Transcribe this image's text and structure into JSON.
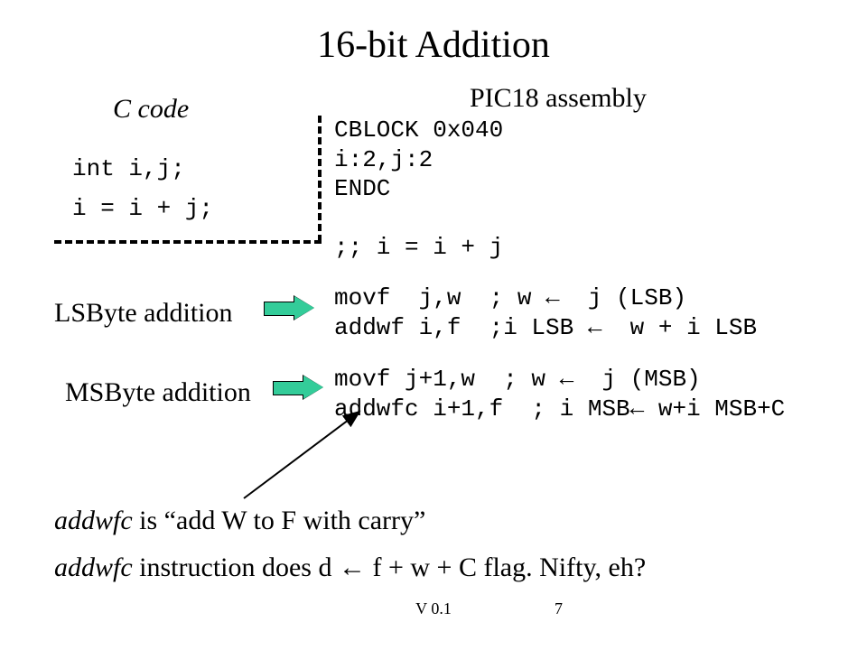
{
  "title": "16-bit Addition",
  "labels": {
    "c_code": "C code",
    "asm": "PIC18 assembly",
    "lsb": "LSByte addition",
    "msb": "MSByte addition"
  },
  "c_code": {
    "line1": "int i,j;",
    "line2": "i = i + j;"
  },
  "asm": {
    "block": "CBLOCK 0x040\ni:2,j:2\nENDC\n\n;; i = i + j",
    "lsb": "movf  j,w  ; w ←  j (LSB)\naddwf i,f  ;i LSB ←  w + i LSB",
    "msb": "movf j+1,w  ; w ←  j (MSB)\naddwfc i+1,f  ; i MSB← w+i MSB+C"
  },
  "footnotes": {
    "f1_pre": "addwfc",
    "f1_post": " is “add W to F with carry”",
    "f2_pre": "addwfc",
    "f2_post": " instruction does  d ← f + w + C flag.    Nifty, eh?"
  },
  "footer": {
    "version": "V 0.1",
    "page": "7"
  },
  "colors": {
    "arrow_fill": "#33cc99"
  }
}
